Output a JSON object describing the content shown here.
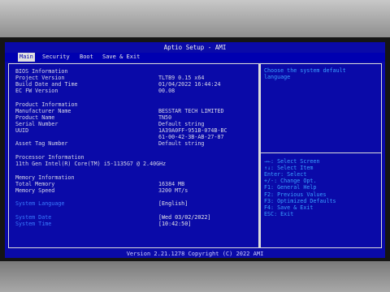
{
  "app_title": "Aptio Setup - AMI",
  "menu": [
    "Main",
    "Security",
    "Boot",
    "Save & Exit"
  ],
  "rows": [
    {
      "label": "BIOS Information",
      "value": "",
      "type": "text"
    },
    {
      "label": "Project Version",
      "value": "TLTB9 0.15 x64",
      "type": "text"
    },
    {
      "label": "Build Date and Time",
      "value": "01/04/2022 16:44:24",
      "type": "text"
    },
    {
      "label": "EC FW Version",
      "value": "00.08",
      "type": "text"
    },
    {
      "label": "Product Information",
      "value": "",
      "type": "text"
    },
    {
      "label": "Manufacturer Name",
      "value": "BESSTAR TECH LIMITED",
      "type": "text"
    },
    {
      "label": "Product Name",
      "value": "TN50",
      "type": "text"
    },
    {
      "label": "Serial Number",
      "value": "Default string",
      "type": "text"
    },
    {
      "label": "UUID",
      "value": "1A39A0FF-951B-074B-BC",
      "type": "text"
    },
    {
      "label": "",
      "value": "61-00-42-3B-AB-27-87",
      "type": "text"
    },
    {
      "label": "Asset Tag Number",
      "value": "Default string",
      "type": "text"
    },
    {
      "label": "Processor Information",
      "value": "",
      "type": "text"
    },
    {
      "label": "11th Gen Intel(R) Core(TM) i5-1135G7 @ 2.40GHz",
      "value": "",
      "type": "text"
    },
    {
      "label": "Memory Information",
      "value": "",
      "type": "text"
    },
    {
      "label": "Total Memory",
      "value": "16384 MB",
      "type": "text"
    },
    {
      "label": "Memory Speed",
      "value": "3200 MT/s",
      "type": "text"
    },
    {
      "label": "System Language",
      "value": "[English]",
      "type": "option"
    },
    {
      "label": "System Date",
      "value": "[Wed 03/02/2022]",
      "type": "option"
    },
    {
      "label": "System Time",
      "value": "[10:42:50]",
      "type": "option"
    }
  ],
  "help": [
    "Choose the system default",
    "language"
  ],
  "keys": [
    "→←: Select Screen",
    "↑↓: Select Item",
    "Enter: Select",
    "+/-: Change Opt.",
    "F1: General Help",
    "F2: Previous Values",
    "F3: Optimized Defaults",
    "F4: Save & Exit",
    "ESC: Exit"
  ],
  "footer": "Version 2.21.1278 Copyright (C) 2022 AMI",
  "colors": {
    "background": "#0a0aa8",
    "option_label": "#3a7cff",
    "help_text": "#3aa0ff",
    "selected_tab": "#e0e0e0"
  }
}
